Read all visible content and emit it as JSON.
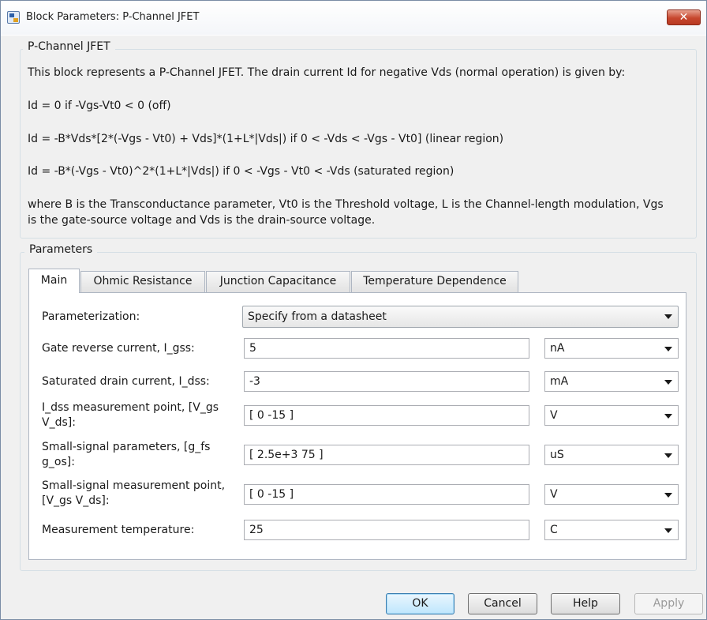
{
  "window": {
    "title": "Block Parameters: P-Channel JFET",
    "close_glyph": "✕"
  },
  "description": {
    "legend": "P-Channel JFET",
    "lines": [
      "This block represents a P-Channel JFET. The drain current Id for negative Vds (normal operation) is given by:",
      "Id = 0 if -Vgs-Vt0 < 0 (off)",
      "Id = -B*Vds*[2*(-Vgs - Vt0) + Vds]*(1+L*|Vds|) if 0 < -Vds < -Vgs - Vt0] (linear region)",
      "Id = -B*(-Vgs - Vt0)^2*(1+L*|Vds|) if 0 < -Vgs - Vt0 < -Vds (saturated region)",
      "where B is the Transconductance parameter, Vt0 is the Threshold voltage, L is the Channel-length modulation, Vgs",
      "is the gate-source voltage and Vds is the drain-source voltage."
    ]
  },
  "parameters": {
    "legend": "Parameters",
    "tabs": [
      {
        "label": "Main",
        "active": true
      },
      {
        "label": "Ohmic Resistance",
        "active": false
      },
      {
        "label": "Junction Capacitance",
        "active": false
      },
      {
        "label": "Temperature Dependence",
        "active": false
      }
    ],
    "parameterization": {
      "label": "Parameterization:",
      "value": "Specify from a datasheet"
    },
    "rows": [
      {
        "label_lines": [
          "Gate reverse current, I_gss:"
        ],
        "value": "5",
        "unit": "nA"
      },
      {
        "label_lines": [
          "Saturated drain current, I_dss:"
        ],
        "value": "-3",
        "unit": "mA"
      },
      {
        "label_lines": [
          "I_dss measurement point, [V_gs",
          "V_ds]:"
        ],
        "value": "[ 0 -15 ]",
        "unit": "V"
      },
      {
        "label_lines": [
          "Small-signal parameters, [g_fs",
          "g_os]:"
        ],
        "value": "[ 2.5e+3 75 ]",
        "unit": "uS"
      },
      {
        "label_lines": [
          "Small-signal measurement point,",
          "[V_gs V_ds]:"
        ],
        "value": "[ 0 -15 ]",
        "unit": "V"
      },
      {
        "label_lines": [
          "Measurement temperature:"
        ],
        "value": "25",
        "unit": "C"
      }
    ]
  },
  "buttons": {
    "ok": "OK",
    "cancel": "Cancel",
    "help": "Help",
    "apply": "Apply"
  },
  "colors": {
    "window_bg": "#f0f0f0",
    "close_button": "#c7472e",
    "default_button_border": "#3c7fb1"
  }
}
